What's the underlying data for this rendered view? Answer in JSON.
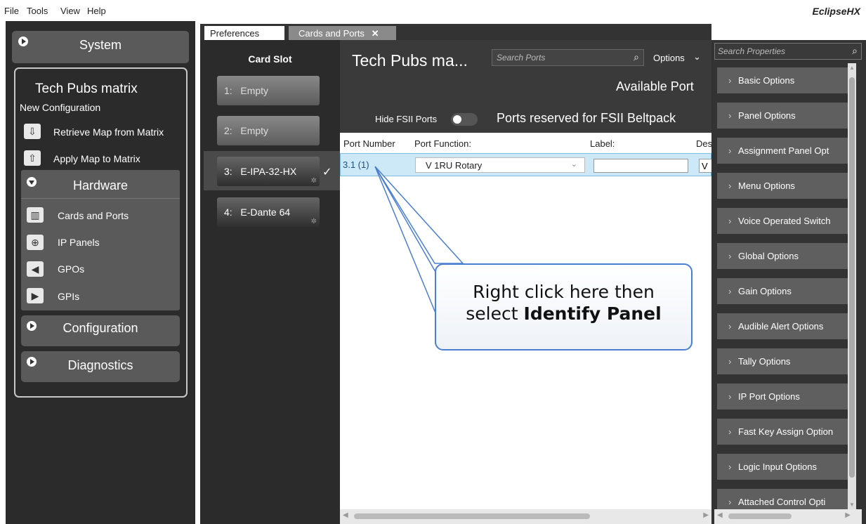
{
  "menu": {
    "file": "File",
    "tools": "Tools",
    "view": "View",
    "help": "Help",
    "logo": "EclipseHX"
  },
  "left": {
    "system": "System",
    "project_title": "Tech Pubs matrix",
    "project_sub": "New Configuration",
    "retrieve": "Retrieve Map from Matrix",
    "apply": "Apply Map to Matrix",
    "hardware": "Hardware",
    "hw_items": [
      "Cards and Ports",
      "IP Panels",
      "GPOs",
      "GPIs"
    ],
    "configuration": "Configuration",
    "diagnostics": "Diagnostics"
  },
  "tabs": {
    "preferences": "Preferences",
    "cards": "Cards and Ports",
    "close": "✕"
  },
  "cards": {
    "header": "Card Slot",
    "slots": [
      {
        "num": "1:",
        "name": "Empty"
      },
      {
        "num": "2:",
        "name": "Empty"
      },
      {
        "num": "3:",
        "name": "E-IPA-32-HX",
        "check": "✓"
      },
      {
        "num": "4:",
        "name": "E-Dante 64"
      }
    ]
  },
  "main": {
    "title": "Tech Pubs ma...",
    "search_placeholder": "Search Ports",
    "options": "Options",
    "available": "Available Port",
    "hide_fsii": "Hide FSII Ports",
    "reserved": "Ports reserved for FSII Beltpack",
    "columns": [
      "Port Number",
      "Port Function:",
      "Label:",
      "Des"
    ],
    "row": {
      "port": "3.1 (1)",
      "function": "V 1RU Rotary",
      "label": "",
      "des": "V"
    },
    "callout_line1": "Right click here then",
    "callout_line2a": "select ",
    "callout_line2b": "Identify Panel"
  },
  "right": {
    "search_placeholder": "Search Properties",
    "items": [
      "Basic Options",
      "Panel Options",
      "Assignment Panel Opt",
      "Menu Options",
      "Voice Operated Switch",
      "Global Options",
      "Gain Options",
      "Audible Alert Options",
      "Tally Options",
      "IP Port Options",
      "Fast Key Assign Option",
      "Logic Input Options",
      "Attached Control Opti"
    ]
  }
}
